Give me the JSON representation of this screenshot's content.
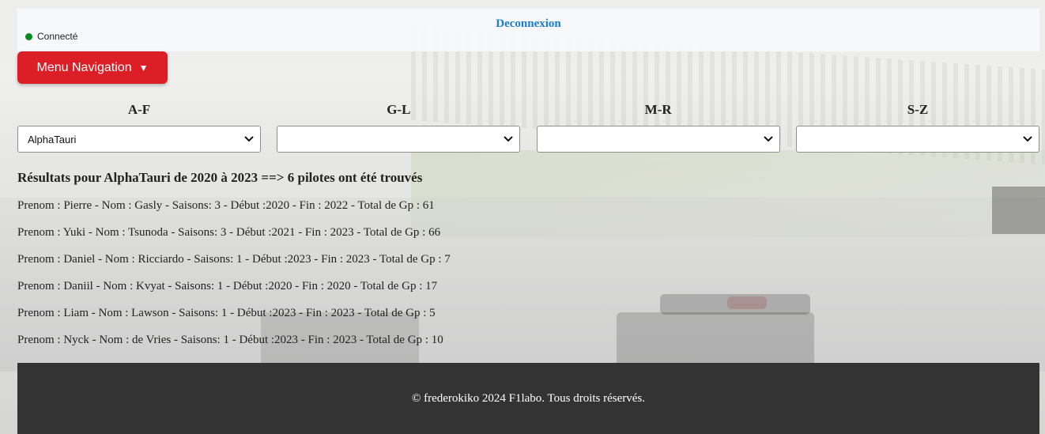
{
  "header": {
    "logout_label": "Deconnexion",
    "status_text": "Connecté",
    "status_color": "#0a8a1e"
  },
  "navigation": {
    "menu_label": "Menu Navigation",
    "menu_caret": "▼",
    "accent_color": "#dc1f27"
  },
  "filters": {
    "groups": [
      {
        "label": "A-F",
        "selected": "AlphaTauri"
      },
      {
        "label": "G-L",
        "selected": ""
      },
      {
        "label": "M-R",
        "selected": ""
      },
      {
        "label": "S-Z",
        "selected": ""
      }
    ]
  },
  "results": {
    "title": "Résultats pour AlphaTauri de 2020 à 2023 ==> 6 pilotes ont été trouvés",
    "pilots": [
      "Prenom : Pierre - Nom : Gasly - Saisons: 3 - Début :2020 - Fin : 2022 - Total de Gp : 61",
      "Prenom : Yuki - Nom : Tsunoda - Saisons: 3 - Début :2021 - Fin : 2023 - Total de Gp : 66",
      "Prenom : Daniel - Nom : Ricciardo - Saisons: 1 - Début :2023 - Fin : 2023 - Total de Gp : 7",
      "Prenom : Daniil - Nom : Kvyat - Saisons: 1 - Début :2020 - Fin : 2020 - Total de Gp : 17",
      "Prenom : Liam - Nom : Lawson - Saisons: 1 - Début :2023 - Fin : 2023 - Total de Gp : 5",
      "Prenom : Nyck - Nom : de Vries - Saisons: 1 - Début :2023 - Fin : 2023 - Total de Gp : 10"
    ]
  },
  "footer": {
    "text": "© frederokiko 2024 F1labo. Tous droits réservés."
  }
}
